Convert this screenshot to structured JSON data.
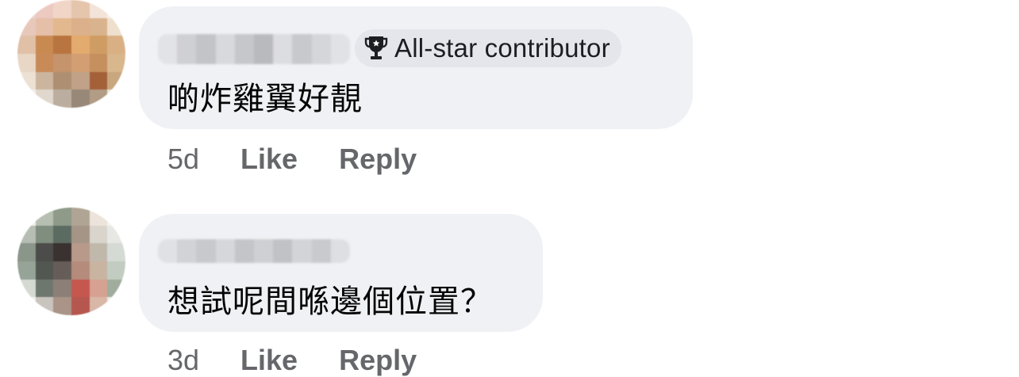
{
  "comments": [
    {
      "badge": {
        "icon": "trophy-icon",
        "label": "All-star contributor"
      },
      "text": "啲炸雞翼好靚",
      "time": "5d",
      "like_label": "Like",
      "reply_label": "Reply"
    },
    {
      "text": "想試呢間喺邊個位置？",
      "time": "3d",
      "like_label": "Like",
      "reply_label": "Reply"
    }
  ],
  "colors": {
    "bubble_bg": "#eff1f4",
    "badge_bg": "#e4e6eb",
    "secondary_text": "#65676b",
    "primary_text": "#050505"
  }
}
